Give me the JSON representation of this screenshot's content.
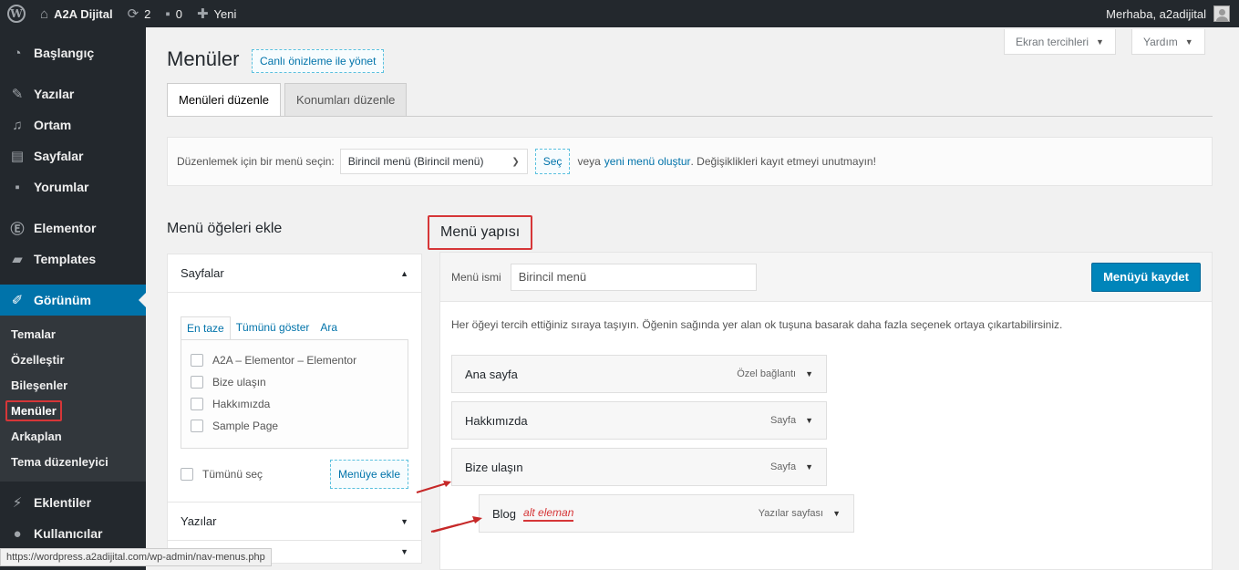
{
  "adminbar": {
    "site_name": "A2A Dijital",
    "updates_count": "2",
    "comments_count": "0",
    "new_label": "Yeni",
    "greeting": "Merhaba, a2adijital"
  },
  "sidebar": {
    "items_top": [
      {
        "label": "Başlangıç",
        "icon": "dashboard-icon"
      },
      {
        "label": "Yazılar",
        "icon": "pin-icon"
      },
      {
        "label": "Ortam",
        "icon": "media-icon"
      },
      {
        "label": "Sayfalar",
        "icon": "pages-icon"
      },
      {
        "label": "Yorumlar",
        "icon": "comments-icon"
      },
      {
        "label": "Elementor",
        "icon": "elementor-icon"
      },
      {
        "label": "Templates",
        "icon": "folder-icon"
      },
      {
        "label": "Görünüm",
        "icon": "brush-icon"
      }
    ],
    "submenu": [
      "Temalar",
      "Özelleştir",
      "Bileşenler",
      "Menüler",
      "Arkaplan",
      "Tema düzenleyici"
    ],
    "items_bottom": [
      {
        "label": "Eklentiler",
        "icon": "plugins-icon"
      },
      {
        "label": "Kullanıcılar",
        "icon": "users-icon"
      }
    ]
  },
  "screen_options": {
    "label": "Ekran tercihleri",
    "help": "Yardım"
  },
  "page": {
    "title": "Menüler",
    "live_preview": "Canlı önizleme ile yönet",
    "tabs": [
      "Menüleri düzenle",
      "Konumları düzenle"
    ]
  },
  "select_bar": {
    "prompt": "Düzenlemek için bir menü seçin:",
    "selected": "Birincil menü (Birincil menü)",
    "select_button": "Seç",
    "or_text": "veya",
    "create_link": "yeni menü oluştur",
    "reminder": ". Değişiklikleri kayıt etmeyi unutmayın!"
  },
  "add_items": {
    "title": "Menü öğeleri ekle",
    "pages_panel": "Sayfalar",
    "tabs": [
      "En taze",
      "Tümünü göster",
      "Ara"
    ],
    "pages": [
      "A2A – Elementor – Elementor",
      "Bize ulaşın",
      "Hakkımızda",
      "Sample Page"
    ],
    "select_all": "Tümünü seç",
    "add_button": "Menüye ekle",
    "posts_panel": "Yazılar"
  },
  "structure": {
    "title": "Menü yapısı",
    "name_label": "Menü ismi",
    "name_value": "Birincil menü",
    "save_button": "Menüyü kaydet",
    "instructions": "Her öğeyi tercih ettiğiniz sıraya taşıyın. Öğenin sağında yer alan ok tuşuna basarak daha fazla seçenek ortaya çıkartabilirsiniz.",
    "items": [
      {
        "label": "Ana sayfa",
        "type": "Özel bağlantı"
      },
      {
        "label": "Hakkımızda",
        "type": "Sayfa"
      },
      {
        "label": "Bize ulaşın",
        "type": "Sayfa"
      },
      {
        "label": "Blog",
        "type": "Yazılar sayfası",
        "sub_tag": "alt eleman"
      }
    ]
  },
  "status_url": "https://wordpress.a2adijital.com/wp-admin/nav-menus.php",
  "colors": {
    "admin_bg": "#23282d",
    "accent": "#0073aa",
    "highlight": "#d63638"
  }
}
